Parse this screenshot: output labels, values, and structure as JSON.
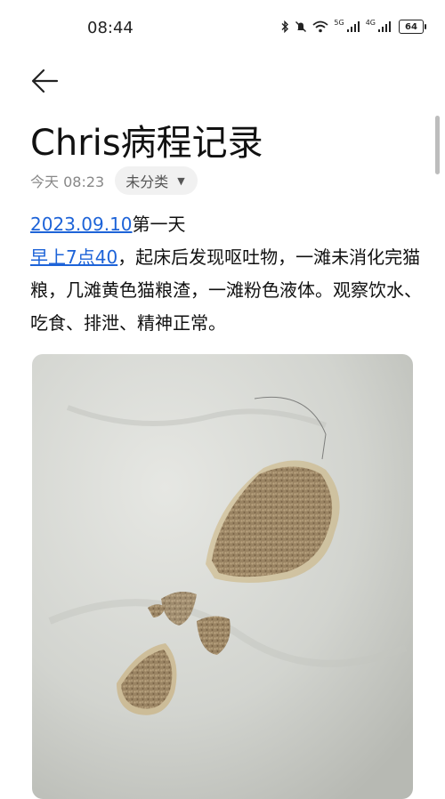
{
  "status_bar": {
    "time": "08:44",
    "net1": "5G",
    "net2": "4G",
    "battery": "64",
    "icons": [
      "bluetooth-icon",
      "mute-icon",
      "wifi-icon",
      "signal-icon",
      "signal-icon",
      "battery-icon"
    ]
  },
  "nav": {
    "back_icon": "arrow-left-icon"
  },
  "note": {
    "title": "Chris病程记录",
    "time": "今天 08:23",
    "category": "未分类",
    "date_link": "2023.09.10",
    "date_suffix": "第一天",
    "time_link": "早上7点40",
    "body": "，起床后发现呕吐物，一滩未消化完猫粮，几滩黄色猫粮渣，一滩粉色液体。观察饮水、吃食、排泄、精神正常。"
  },
  "colors": {
    "link": "#1d63d8",
    "chip_bg": "#f1f1f1",
    "meta": "#888888"
  }
}
